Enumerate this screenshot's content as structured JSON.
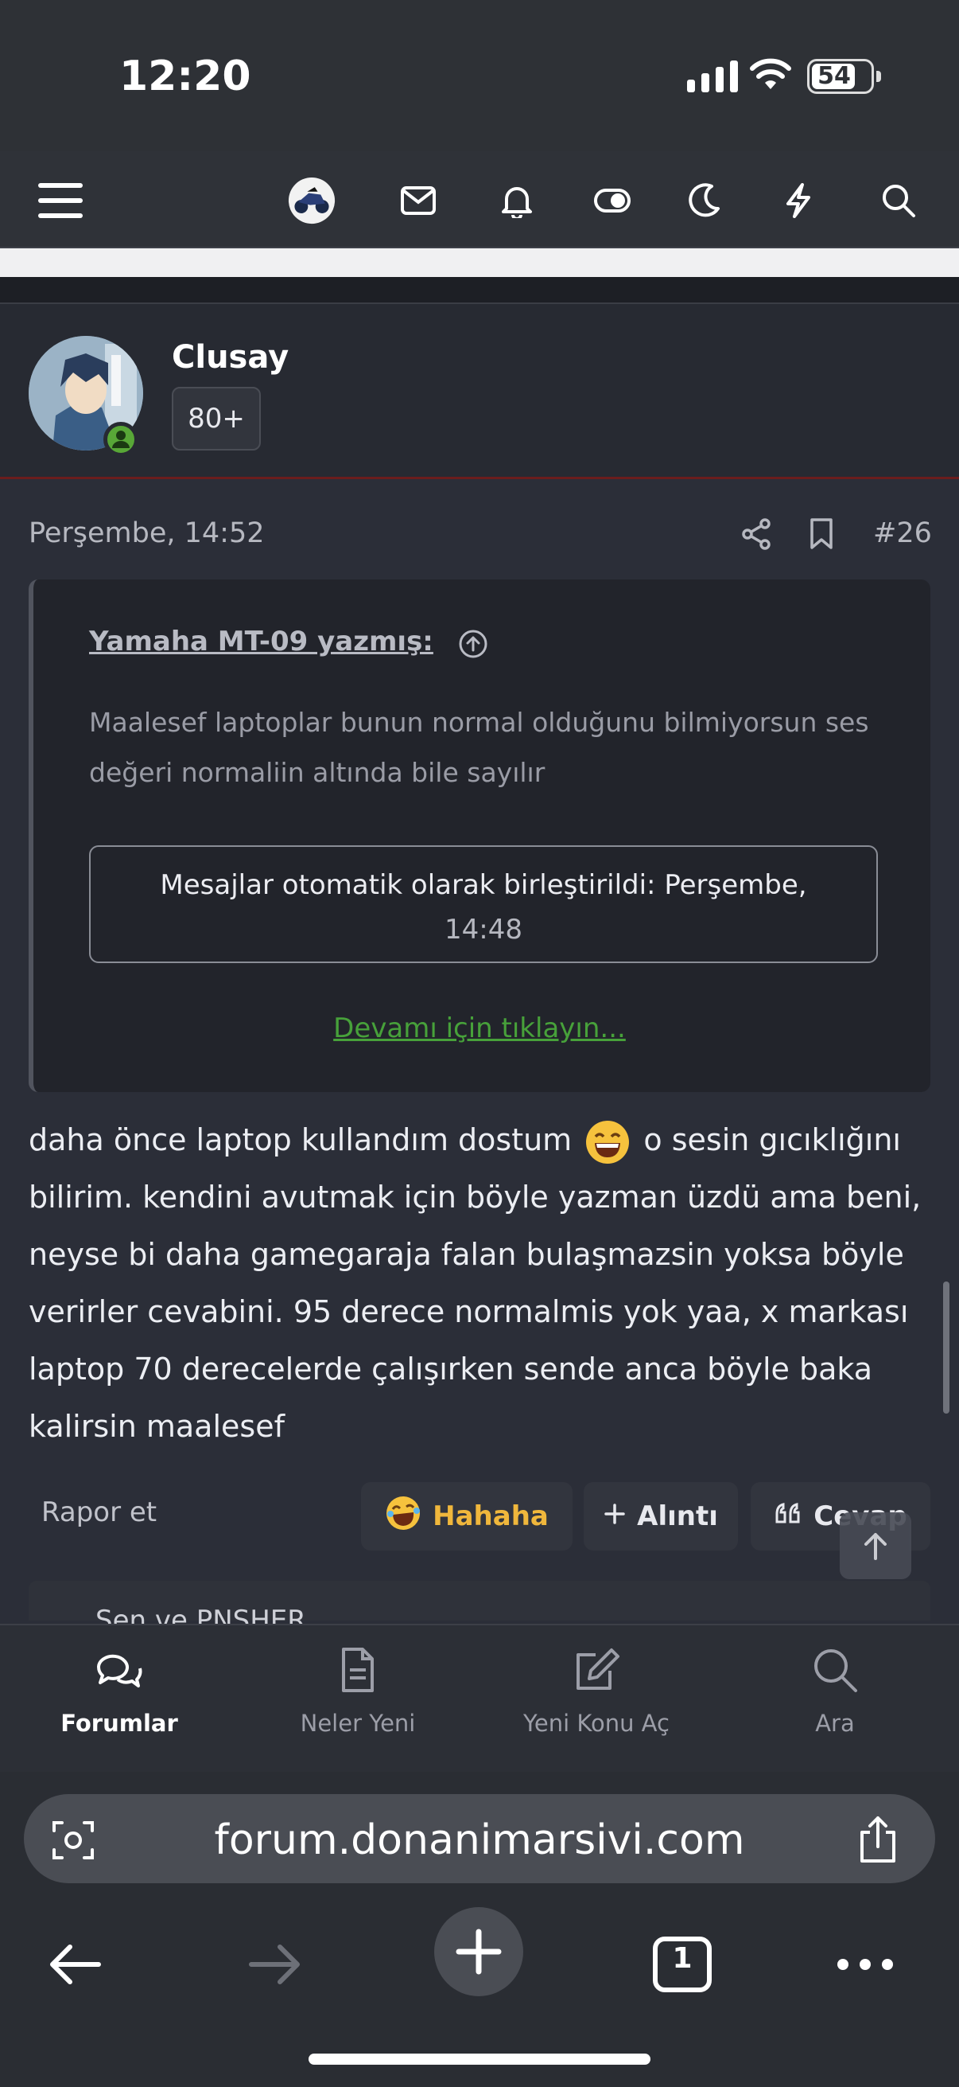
{
  "status_bar": {
    "time": "12:20",
    "battery": "54"
  },
  "header": {
    "icons": [
      "menu-icon",
      "avatar-moto",
      "mail-icon",
      "bell-icon",
      "toggle-icon",
      "moon-icon",
      "bolt-icon",
      "search-icon"
    ]
  },
  "author": {
    "name": "Clusay",
    "badge": "80+"
  },
  "post": {
    "date": "Perşembe, 14:52",
    "number": "#26",
    "quote": {
      "author": "Yamaha MT-09 yazmış:",
      "text": "Maalesef laptoplar bunun normal olduğunu bilmiyorsun ses değeri normaliin altında bile sayılır",
      "merge_line1": "Mesajlar otomatik olarak birleştirildi: Perşembe,",
      "merge_line2": "14:48",
      "more_link": "Devamı için tıklayın..."
    },
    "body_part1": "daha önce laptop kullandım dostum",
    "body_part2": "o sesin gıcıklığını bilirim. kendini avutmak için böyle yazman üzdü ama beni, neyse bi daha gamegaraja falan bulaşmazsin yoksa böyle verirler cevabini. 95 derece normalmis yok yaa, x markası laptop 70 derecelerde çalışırken sende anca böyle baka kalirsin maalesef"
  },
  "actions": {
    "report": "Rapor et",
    "haha": "Hahaha",
    "quote": "Alıntı",
    "reply": "Cevap"
  },
  "reactions_summary": "Sen ve PNSHER",
  "tabbar": {
    "tabs": [
      {
        "label": "Forumlar",
        "icon": "chat-bubbles-icon",
        "active": true
      },
      {
        "label": "Neler Yeni",
        "icon": "document-icon",
        "active": false
      },
      {
        "label": "Yeni Konu Aç",
        "icon": "edit-icon",
        "active": false
      },
      {
        "label": "Ara",
        "icon": "search-icon",
        "active": false
      }
    ]
  },
  "browser": {
    "url": "forum.donanimarsivi.com",
    "tab_count": "1"
  },
  "colors": {
    "accent_green": "#47a13a",
    "haha_yellow": "#f0b73c"
  }
}
